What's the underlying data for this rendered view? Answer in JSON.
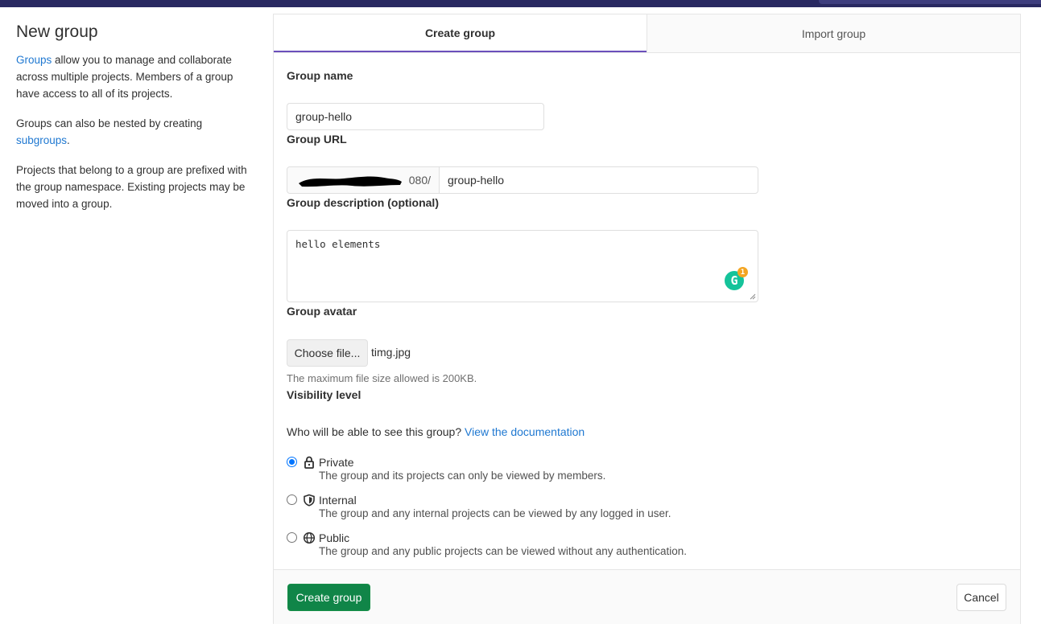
{
  "sidebar": {
    "title": "New group",
    "p1_link": "Groups",
    "p1_text": " allow you to manage and collaborate across multiple projects. Members of a group have access to all of its projects.",
    "p2_text": "Groups can also be nested by creating ",
    "p2_link": "subgroups",
    "p2_end": ".",
    "p3_text": "Projects that belong to a group are prefixed with the group namespace. Existing projects may be moved into a group."
  },
  "tabs": {
    "create": "Create group",
    "import": "Import group"
  },
  "form": {
    "name_label": "Group name",
    "name_value": "group-hello",
    "url_label": "Group URL",
    "url_prefix": "080/",
    "url_path": "group-hello",
    "desc_label": "Group description (optional)",
    "desc_value": "hello elements",
    "grammarly_letter": "G",
    "grammarly_count": "1",
    "avatar_label": "Group avatar",
    "choose_file": "Choose file...",
    "file_name": "timg.jpg",
    "avatar_help": "The maximum file size allowed is 200KB.",
    "visibility_label": "Visibility level",
    "visibility_question": "Who will be able to see this group? ",
    "visibility_link": "View the documentation",
    "visibility": [
      {
        "title": "Private",
        "desc": "The group and its projects can only be viewed by members.",
        "icon": "lock-icon",
        "checked": true
      },
      {
        "title": "Internal",
        "desc": "The group and any internal projects can be viewed by any logged in user.",
        "icon": "shield-icon",
        "checked": false
      },
      {
        "title": "Public",
        "desc": "The group and any public projects can be viewed without any authentication.",
        "icon": "globe-icon",
        "checked": false
      }
    ]
  },
  "footer": {
    "create_label": "Create group",
    "cancel_label": "Cancel"
  },
  "colors": {
    "topbar": "#292961",
    "link": "#1f78d1",
    "primary": "#108548",
    "tab_underline": "#6b4fbb"
  }
}
